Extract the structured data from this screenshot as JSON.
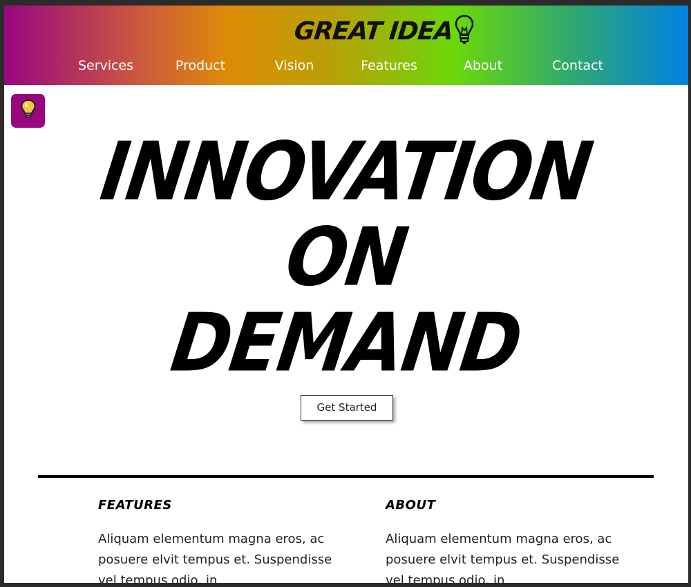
{
  "header": {
    "logo_text": "GREAT IDEA",
    "logo_icon": "lightbulb-icon",
    "nav": [
      {
        "label": "Services"
      },
      {
        "label": "Product"
      },
      {
        "label": "Vision"
      },
      {
        "label": "Features"
      },
      {
        "label": "About"
      },
      {
        "label": "Contact"
      }
    ],
    "gradient_colors": [
      "#98077f",
      "#dd8c08",
      "#6ad80a",
      "#0181e3"
    ]
  },
  "side_button": {
    "icon": "lightbulb-icon",
    "color": "#98077f"
  },
  "hero": {
    "lines": [
      "INNOVATION",
      "ON",
      "DEMAND"
    ],
    "cta_label": "Get Started"
  },
  "columns": [
    {
      "title": "FEATURES",
      "body": "Aliquam elementum magna eros, ac posuere elvit tempus et. Suspendisse vel tempus odio, in"
    },
    {
      "title": "ABOUT",
      "body": "Aliquam elementum magna eros, ac posuere elvit tempus et. Suspendisse vel tempus odio, in"
    }
  ]
}
